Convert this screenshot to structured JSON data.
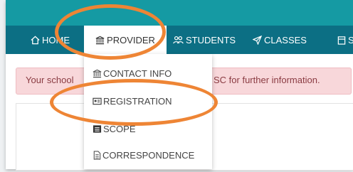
{
  "nav": {
    "items": [
      {
        "label": "HOME",
        "icon": "home-icon"
      },
      {
        "label": "PROVIDER",
        "icon": "bank-icon"
      },
      {
        "label": "STUDENTS",
        "icon": "users-icon"
      },
      {
        "label": "CLASSES",
        "icon": "send-icon"
      },
      {
        "label": "S",
        "icon": "calendar-icon"
      }
    ]
  },
  "dropdown": {
    "items": [
      {
        "label": "CONTACT INFO",
        "icon": "bank-icon"
      },
      {
        "label": "REGISTRATION",
        "icon": "id-card-icon"
      },
      {
        "label": "SCOPE",
        "icon": "list-icon"
      },
      {
        "label": "CORRESPONDENCE",
        "icon": "document-icon"
      }
    ]
  },
  "alert": {
    "text_left": "Your school",
    "text_right": "SC for further information."
  },
  "colors": {
    "topbar": "#159aa3",
    "navbar": "#0c6f84",
    "alert_bg": "#f8d7da",
    "annotation": "#ee8535"
  }
}
